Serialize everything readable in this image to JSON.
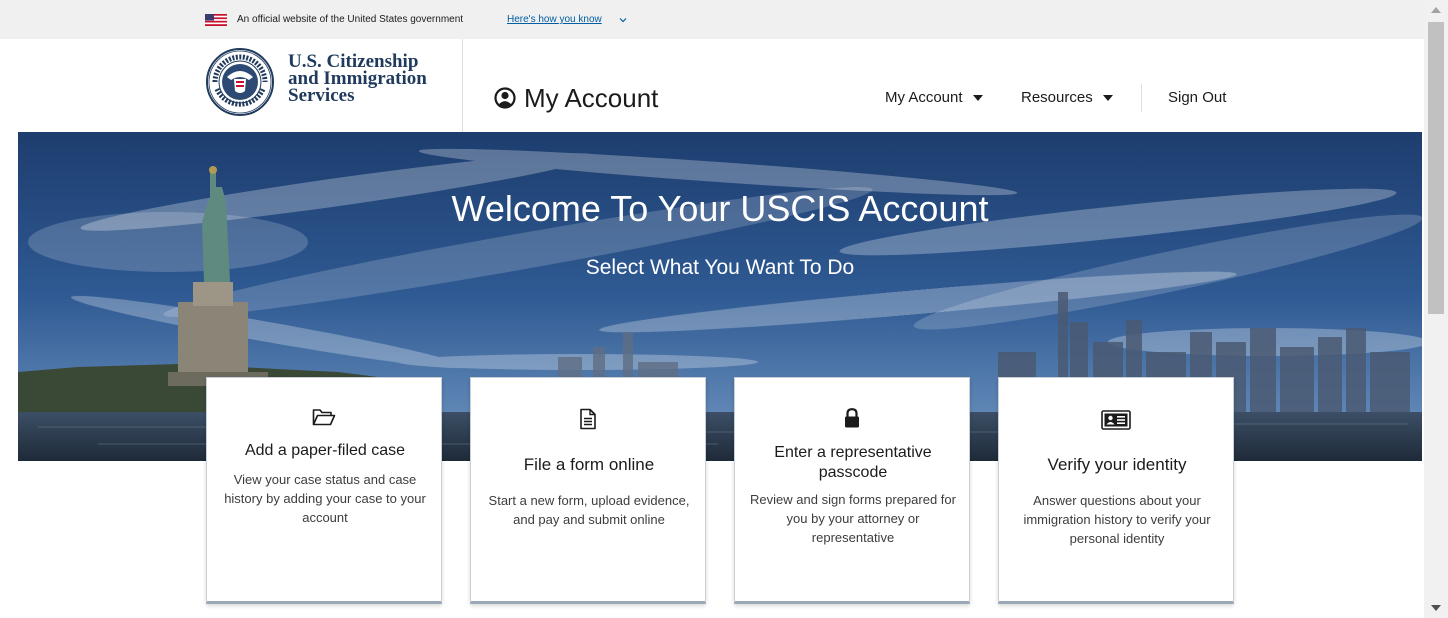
{
  "gov_banner": {
    "official_text": "An official website of the United States government",
    "how_you_know_link": "Here's how you know"
  },
  "header": {
    "agency_name_lines": [
      "U.S. Citizenship",
      "and Immigration",
      "Services"
    ],
    "page_title": "My Account",
    "nav": {
      "my_account": "My Account",
      "resources": "Resources",
      "sign_out": "Sign Out"
    }
  },
  "hero": {
    "title": "Welcome To Your USCIS Account",
    "subtitle": "Select What You Want To Do"
  },
  "cards": [
    {
      "icon": "folder-open-icon",
      "title": "Add a paper-filed case",
      "description": "View your case status and case history by adding your case to your account"
    },
    {
      "icon": "document-icon",
      "title": "File a form online",
      "description": "Start a new form, upload evidence, and pay and submit online"
    },
    {
      "icon": "lock-icon",
      "title": "Enter a representative passcode",
      "description": "Review and sign forms prepared for you by your attorney or representative"
    },
    {
      "icon": "id-card-icon",
      "title": "Verify your identity",
      "description": "Answer questions about your immigration history to verify your personal identity"
    }
  ],
  "colors": {
    "brand_navy": "#1f3a5c",
    "link_blue": "#005ea2",
    "banner_bg": "#f0f0f0"
  }
}
